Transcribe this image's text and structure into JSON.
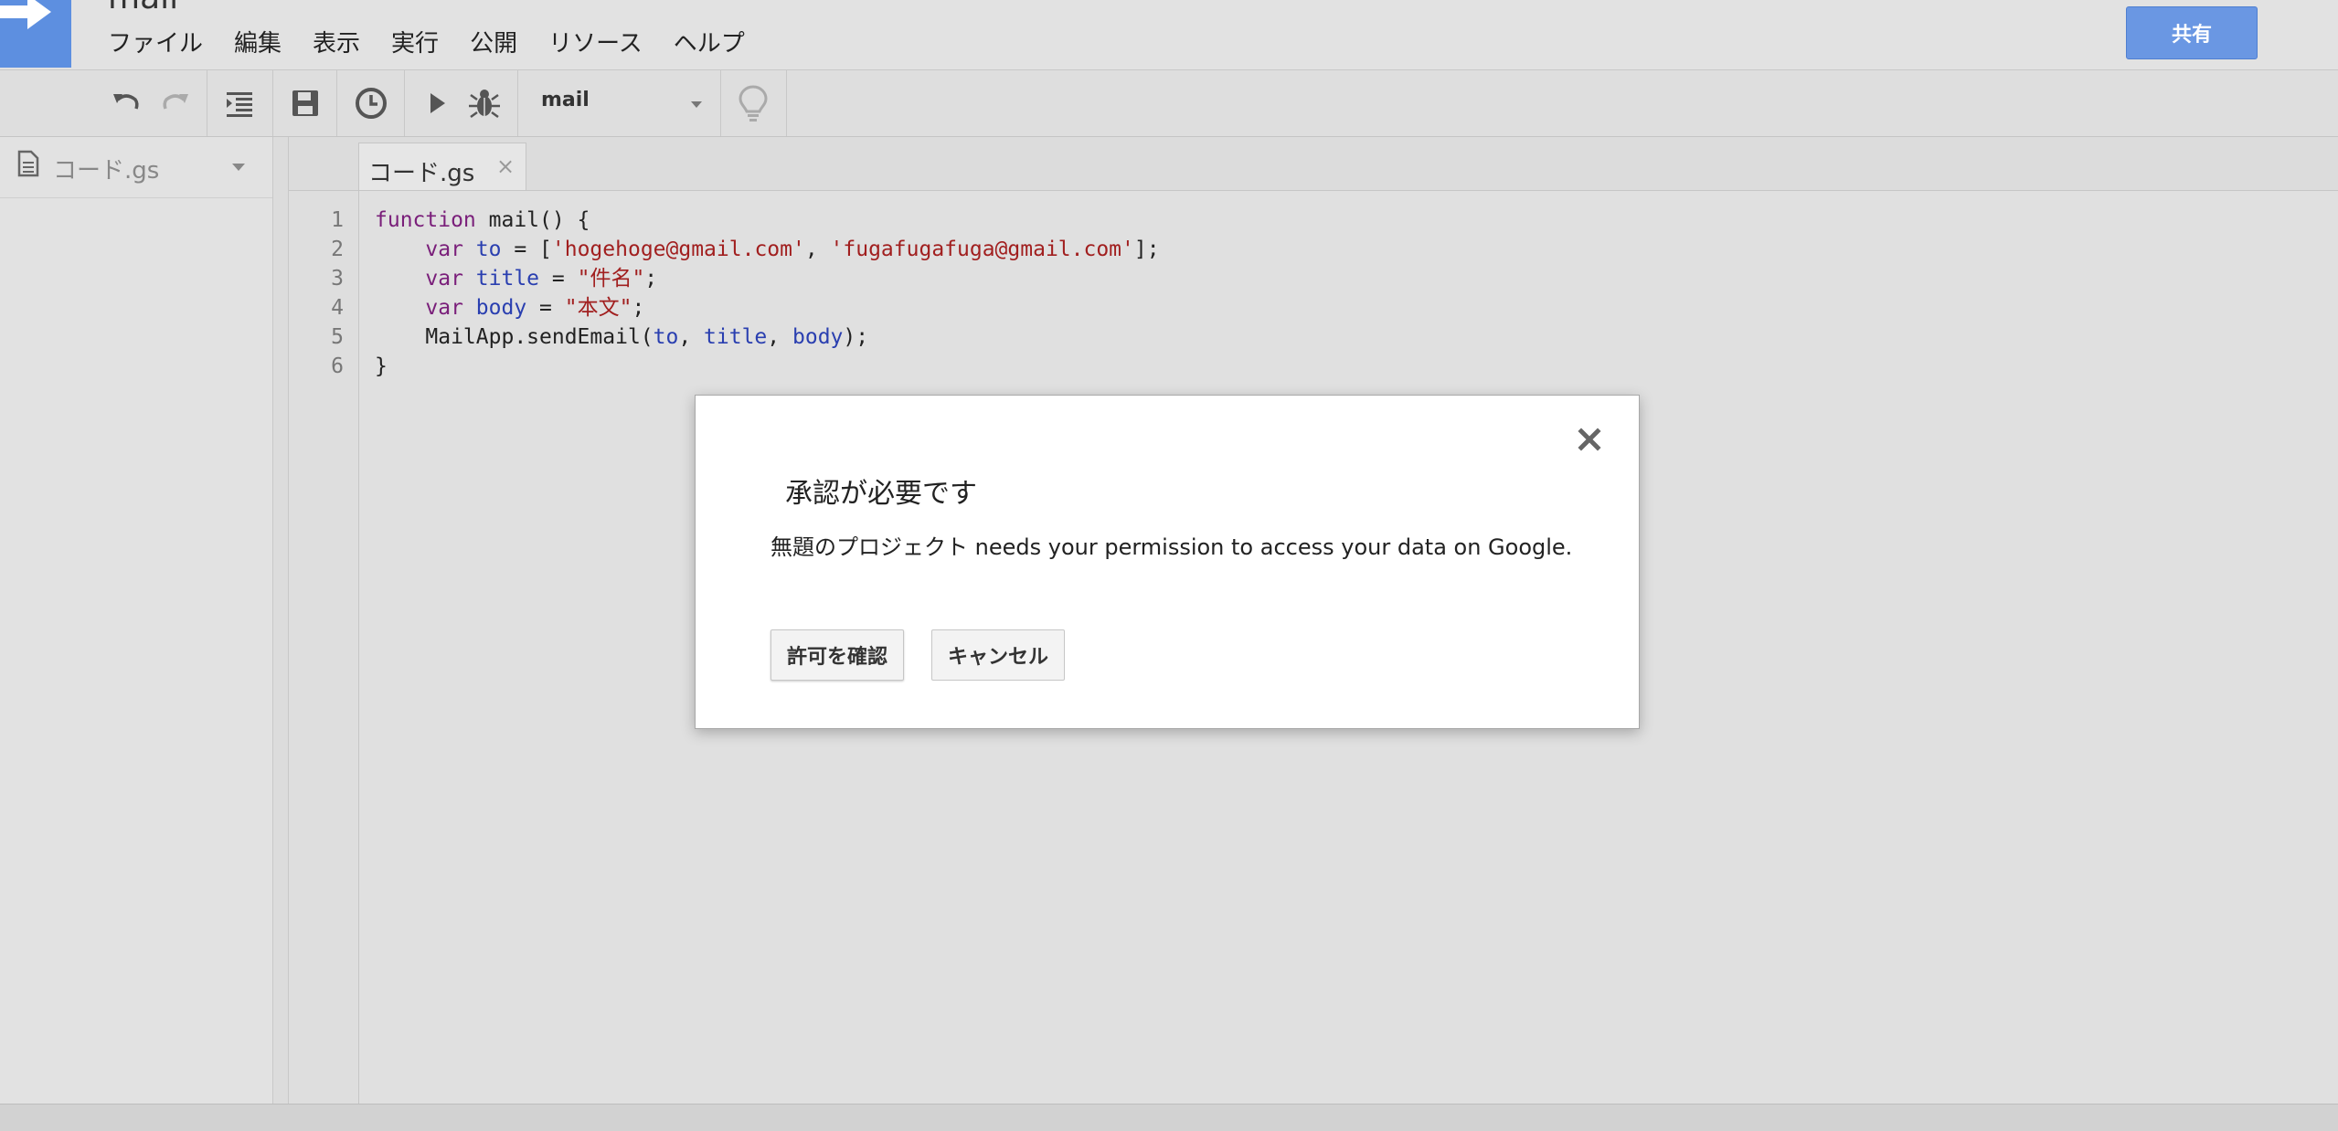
{
  "header": {
    "doc_title": "mail",
    "menu": [
      "ファイル",
      "編集",
      "表示",
      "実行",
      "公開",
      "リソース",
      "ヘルプ"
    ],
    "share_label": "共有"
  },
  "toolbar": {
    "function_select": "mail"
  },
  "sidebar": {
    "file_name": "コード.gs"
  },
  "editor": {
    "tab_name": "コード.gs",
    "tab_close": "×",
    "line_numbers": [
      "1",
      "2",
      "3",
      "4",
      "5",
      "6"
    ],
    "code": {
      "l1_kw": "function",
      "l1_rest": " mail() {",
      "l2_indent": "    ",
      "l2_kw": "var",
      "l2_sp": " ",
      "l2_var": "to",
      "l2_eq": " = [",
      "l2_s1": "'hogehoge@gmail.com'",
      "l2_comma": ", ",
      "l2_s2": "'fugafugafuga@gmail.com'",
      "l2_end": "];",
      "l3_indent": "    ",
      "l3_kw": "var",
      "l3_sp": " ",
      "l3_var": "title",
      "l3_eq": " = ",
      "l3_str": "\"件名\"",
      "l3_end": ";",
      "l4_indent": "    ",
      "l4_kw": "var",
      "l4_sp": " ",
      "l4_var": "body",
      "l4_eq": " = ",
      "l4_str": "\"本文\"",
      "l4_end": ";",
      "l5_indent": "    ",
      "l5_call": "MailApp.sendEmail(",
      "l5_a1": "to",
      "l5_c1": ", ",
      "l5_a2": "title",
      "l5_c2": ", ",
      "l5_a3": "body",
      "l5_end": ");",
      "l6": "}"
    }
  },
  "dialog": {
    "title": "承認が必要です",
    "message": "無題のプロジェクト needs your permission to access your data on Google.",
    "confirm_label": "許可を確認",
    "cancel_label": "キャンセル",
    "close_symbol": "×"
  },
  "colors": {
    "accent": "#5d8fe0",
    "share_button": "#6a97e3",
    "keyword": "#7a1f7a",
    "variable": "#2a3fb0",
    "string": "#a11f1f"
  },
  "icons": [
    "arrow-logo-icon",
    "undo-icon",
    "redo-icon",
    "indent-icon",
    "save-icon",
    "clock-icon",
    "play-icon",
    "bug-icon",
    "lightbulb-icon",
    "file-icon",
    "close-icon"
  ]
}
